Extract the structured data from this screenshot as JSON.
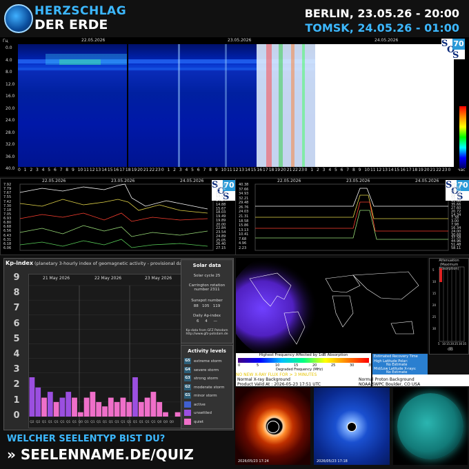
{
  "header": {
    "brand_line1": "HERZSCHLAG",
    "brand_line2": "DER ERDE",
    "time_berlin": "BERLIN, 23.05.26 - 20:00",
    "time_tomsk": "TOMSK, 24.05.26 - 01:00"
  },
  "spectrogram": {
    "axis_unit": "Гц",
    "date_labels": [
      "22.05.2026",
      "23.05.2026",
      "24.05.2026"
    ],
    "y_ticks": [
      "0.0",
      "4.0",
      "8.0",
      "12.0",
      "16.0",
      "20.0",
      "24.0",
      "28.0",
      "32.0",
      "36.0",
      "40.0"
    ],
    "x_unit": "час",
    "sos_number": "70",
    "sos_letters": [
      "S",
      "O",
      "S"
    ]
  },
  "mini_charts": {
    "left": {
      "date_labels": [
        "22.05.2026",
        "23.05.2026",
        "24.05.2026"
      ],
      "left_ticks": [
        "7.92",
        "7.79",
        "7.67",
        "7.55",
        "7.42",
        "7.30",
        "7.18",
        "7.05",
        "6.93",
        "6.80",
        "6.68",
        "6.56",
        "6.43",
        "6.31",
        "6.18",
        "6.06"
      ],
      "right_ticks": [
        "11.16",
        "12.61",
        "13.29",
        "13.90",
        "14.24",
        "14.88",
        "15.67",
        "18.03",
        "19.49",
        "19.89",
        "20.00",
        "22.84",
        "23.54",
        "24.89",
        "25.05",
        "26.40",
        "27.15"
      ],
      "sos_number": "70"
    },
    "right": {
      "date_labels": [
        "22.05.2026",
        "23.05.2026",
        "24.05.2026"
      ],
      "left_ticks": [
        "40.38",
        "37.66",
        "34.93",
        "32.21",
        "29.48",
        "26.76",
        "24.03",
        "21.31",
        "18.58",
        "15.86",
        "13.13",
        "10.41",
        "7.68",
        "4.96",
        "2.23"
      ],
      "right_ticks": [
        "102.94",
        "76.61",
        "68.84",
        "59.48",
        "55.72",
        "41.68",
        "35.66",
        "27.60",
        "20.72",
        "14.34",
        "7.38",
        "3.00",
        "7.98",
        "16.34",
        "24.00",
        "30.68",
        "37.58",
        "44.96",
        "51.48",
        "58.11"
      ],
      "sos_number": "70"
    }
  },
  "kp": {
    "title": "Kp-index",
    "subtitle": "(planetary 3-hourly index of geomagnetic activity - provisional data)",
    "levels": [
      "9",
      "8",
      "7",
      "6",
      "5",
      "4",
      "3",
      "2",
      "1",
      "0"
    ],
    "days": [
      "21 May 2026",
      "22 May 2026",
      "23 May 2026"
    ],
    "bar_codes": [
      "Q2",
      "Q2",
      "Q1",
      "Q1",
      "Q1",
      "Q1",
      "Q1",
      "Q1",
      "Q0",
      "Q1",
      "Q1",
      "Q1",
      "Q1",
      "Q1",
      "Q1",
      "Q1",
      "Q1",
      "Q1",
      "Q1",
      "Q1",
      "Q1",
      "Q0",
      "Q0",
      "Q0"
    ]
  },
  "chart_data": {
    "type": "bar",
    "title": "Kp-index",
    "categories": [
      "21 May 2026",
      "22 May 2026",
      "23 May 2026"
    ],
    "ylim": [
      0,
      9
    ],
    "series": [
      {
        "name": "Kp",
        "values": [
          2.7,
          2.0,
          1.3,
          1.7,
          1.0,
          1.3,
          1.7,
          1.3,
          0.3,
          1.3,
          1.7,
          1.0,
          0.7,
          1.3,
          1.0,
          1.3,
          1.0,
          2.7,
          1.0,
          1.3,
          1.7,
          1.0,
          0.3,
          0.0,
          0.3
        ],
        "colors": [
          "#9b4fe0",
          "#9b4fe0",
          "#ef6fc9",
          "#9b4fe0",
          "#ef6fc9",
          "#9b4fe0",
          "#9b4fe0",
          "#ef6fc9",
          "#ef6fc9",
          "#ef6fc9",
          "#ef6fc9",
          "#ef6fc9",
          "#ef6fc9",
          "#ef6fc9",
          "#ef6fc9",
          "#ef6fc9",
          "#ef6fc9",
          "#9b4fe0",
          "#ef6fc9",
          "#ef6fc9",
          "#ef6fc9",
          "#ef6fc9",
          "#ef6fc9",
          "#ef6fc9",
          "#ef6fc9"
        ]
      }
    ]
  },
  "solar_data": {
    "heading": "Solar data",
    "cycle": "Solar cycle 25",
    "rotation_label": "Carrington rotation number 2311",
    "sunspot_label": "Sunspot number",
    "sunspot_values": "88   105   119",
    "ap_label": "Daily Ap-index",
    "ap_values": "6     4     —",
    "source": "Kp-data from GFZ Potsdam http://www.gfz-potsdam.de"
  },
  "activity_levels": {
    "heading": "Activity levels",
    "items": [
      {
        "code": "G5",
        "label": "extreme storm",
        "color": "#2c5e78"
      },
      {
        "code": "G4",
        "label": "severe storm",
        "color": "#2c5e78"
      },
      {
        "code": "G3",
        "label": "strong storm",
        "color": "#2c5e78"
      },
      {
        "code": "G2",
        "label": "moderate storm",
        "color": "#2c5e78"
      },
      {
        "code": "G1",
        "label": "minor storm",
        "color": "#2c5e78"
      },
      {
        "code": "",
        "label": "active",
        "color": "#4060d0"
      },
      {
        "code": "",
        "label": "unsettled",
        "color": "#9b4fe0"
      },
      {
        "code": "",
        "label": "quiet",
        "color": "#ef6fc9"
      }
    ]
  },
  "drap": {
    "attenuation_title": "Attenuation (Maximum Absorption)",
    "attenuation_ticks": [
      "5",
      "10",
      "15",
      "20",
      "25",
      "30",
      "35"
    ],
    "attenuation_unit": "dB",
    "hf_title": "Highest Frequency Affected by 1dB Absorption",
    "hf_scale": [
      "0",
      "5",
      "10",
      "15",
      "20",
      "25",
      "30",
      "35"
    ],
    "hf_unit": "Degraded Frequency (MHz)",
    "estimated_label": "Estimated Recovery Time",
    "estimated_lines": [
      "High Latitude Polar:",
      "No Estimate",
      "Mid/Low Latitude X-rays:",
      "No Estimate"
    ],
    "xray_note": "NO NEW X-RAY FLUX FOR > 3 MINUTES",
    "xray_bg": "Normal X-ray Background",
    "product_valid": "Product Valid At : 2026-05-23  17:51 UTC",
    "proton_bg": "Normal Proton Background",
    "noaa": "NOAA/SWPC Boulder, CO USA"
  },
  "sun_images": {
    "c2_stamp": "2026/05/23 17:24",
    "c3_stamp": "2026/05/23 17:18"
  },
  "footer": {
    "quiz_question": "WELCHER SEELENTYP BIST DU?",
    "quiz_url": "» SEELENNAME.DE/QUIZ"
  }
}
